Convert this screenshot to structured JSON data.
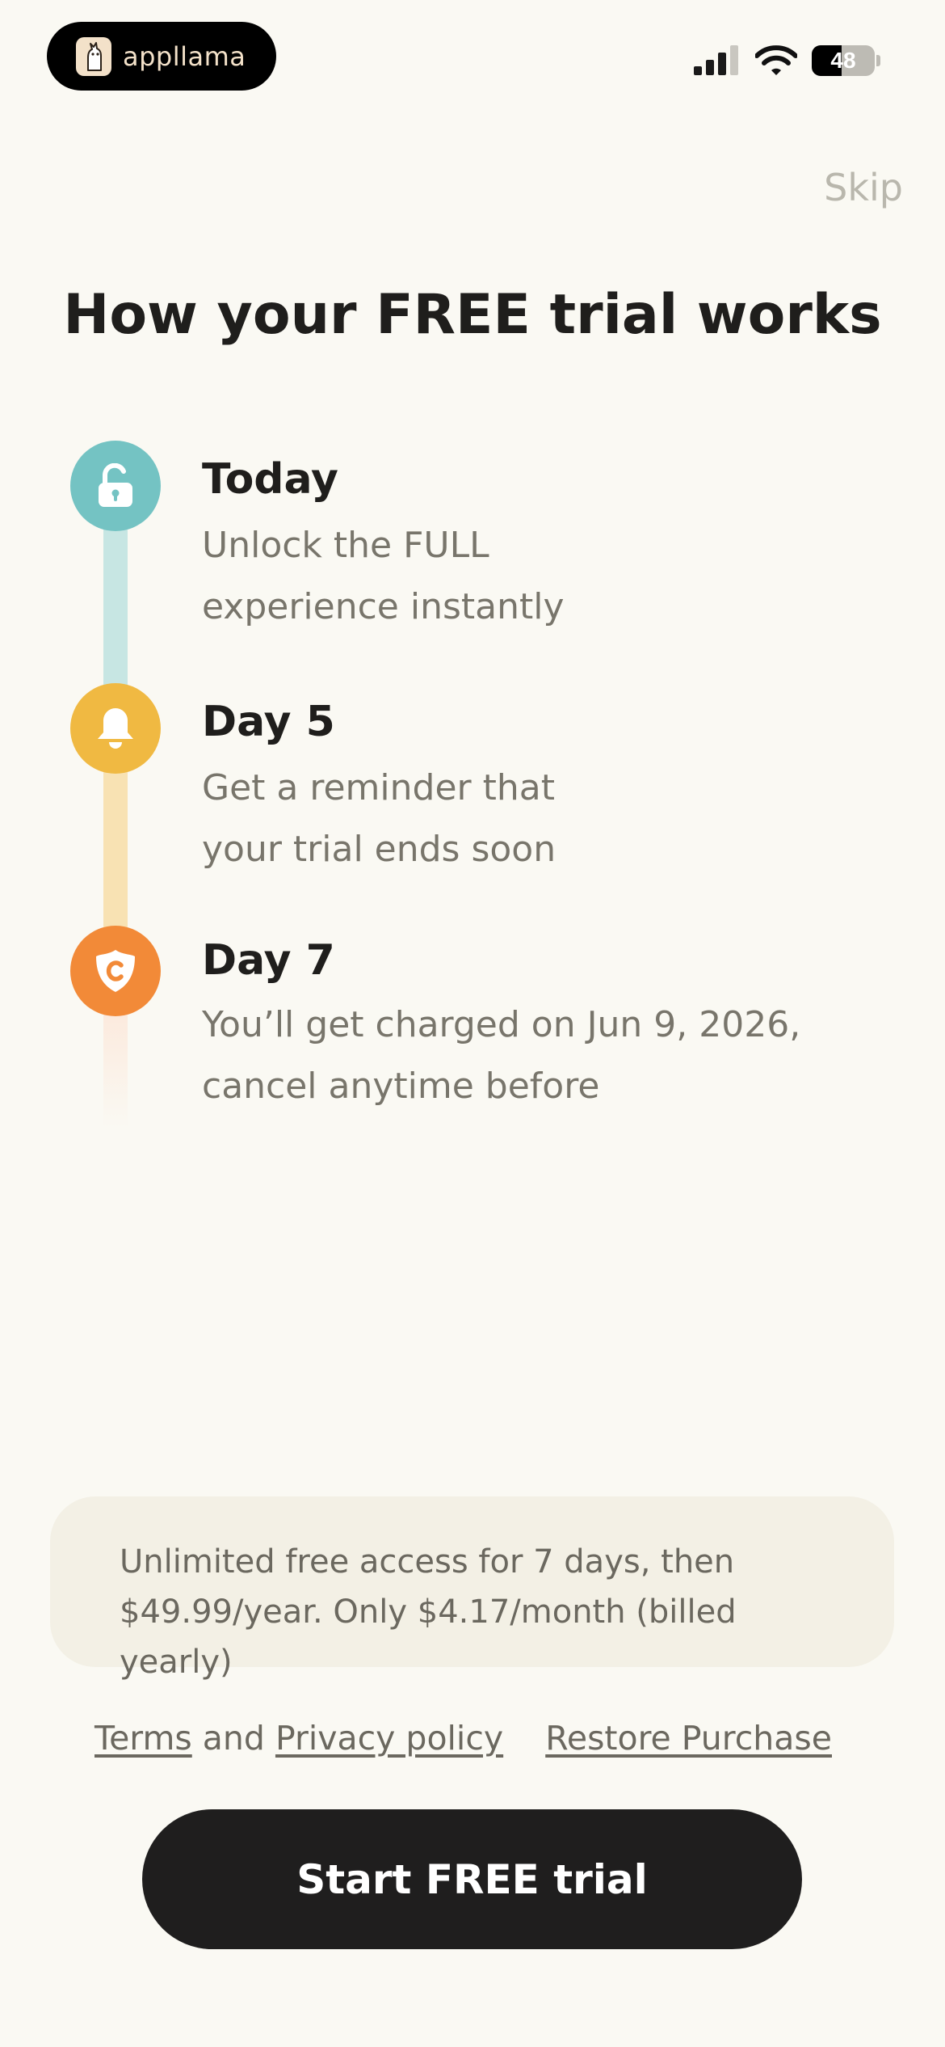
{
  "status_bar": {
    "brand_name": "appllama",
    "battery_level": "48",
    "battery_percent": 48,
    "signal_bars_active": 3,
    "signal_bars_total": 4
  },
  "header": {
    "skip_label": "Skip",
    "title": "How your FREE trial works"
  },
  "timeline": {
    "steps": [
      {
        "heading": "Today",
        "description_line1": "Unlock the FULL",
        "description_line2": "experience instantly",
        "icon": "unlock-icon",
        "color": "#74c3c3"
      },
      {
        "heading": "Day 5",
        "description_line1": "Get a reminder that",
        "description_line2": "your trial ends soon",
        "icon": "bell-icon",
        "color": "#f0b942"
      },
      {
        "heading": "Day 7",
        "description_line1": "You’ll get charged on Jun 9, 2026,",
        "description_line2": "cancel anytime before",
        "icon": "coin-shield-icon",
        "color": "#f28a38"
      }
    ]
  },
  "offer": {
    "line1": "Unlimited free access for 7 days, then",
    "line2": "$49.99/year. Only $4.17/month (billed yearly)"
  },
  "links": {
    "terms": "Terms",
    "and": " and ",
    "privacy": "Privacy policy",
    "restore": "Restore Purchase"
  },
  "cta": {
    "label": "Start FREE trial"
  },
  "colors": {
    "background": "#faf9f3",
    "button": "#1f1e1e",
    "muted_text": "#78756b",
    "offer_box": "#f3f0e5"
  }
}
